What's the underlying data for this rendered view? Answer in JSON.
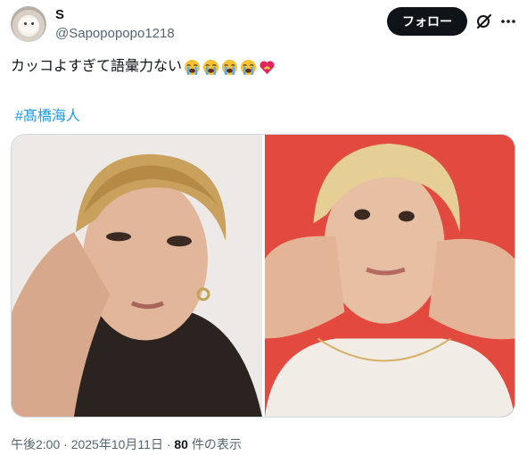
{
  "author": {
    "display_name": "S",
    "handle": "@Sapopopopo1218"
  },
  "actions": {
    "follow_label": "フォロー"
  },
  "tweet": {
    "text": "カッコよすぎて語彙力ない",
    "emojis": [
      "loudly-crying-face",
      "loudly-crying-face",
      "loudly-crying-face",
      "loudly-crying-face",
      "heart-with-ribbon"
    ],
    "hashtag": "#髙橋海人"
  },
  "media": {
    "images": [
      {
        "icon": "photo-portrait-left",
        "background": "#e9e6e3"
      },
      {
        "icon": "photo-portrait-right",
        "background": "#e1483e"
      }
    ]
  },
  "meta": {
    "timestamp": "午後2:00 · 2025年10月11日 · ",
    "view_count": "80",
    "view_suffix": " 件の表示"
  },
  "colors": {
    "accent": "#1d9bf0",
    "primary_text": "#0f1419",
    "secondary_text": "#536471",
    "button_bg": "#0f1419"
  }
}
